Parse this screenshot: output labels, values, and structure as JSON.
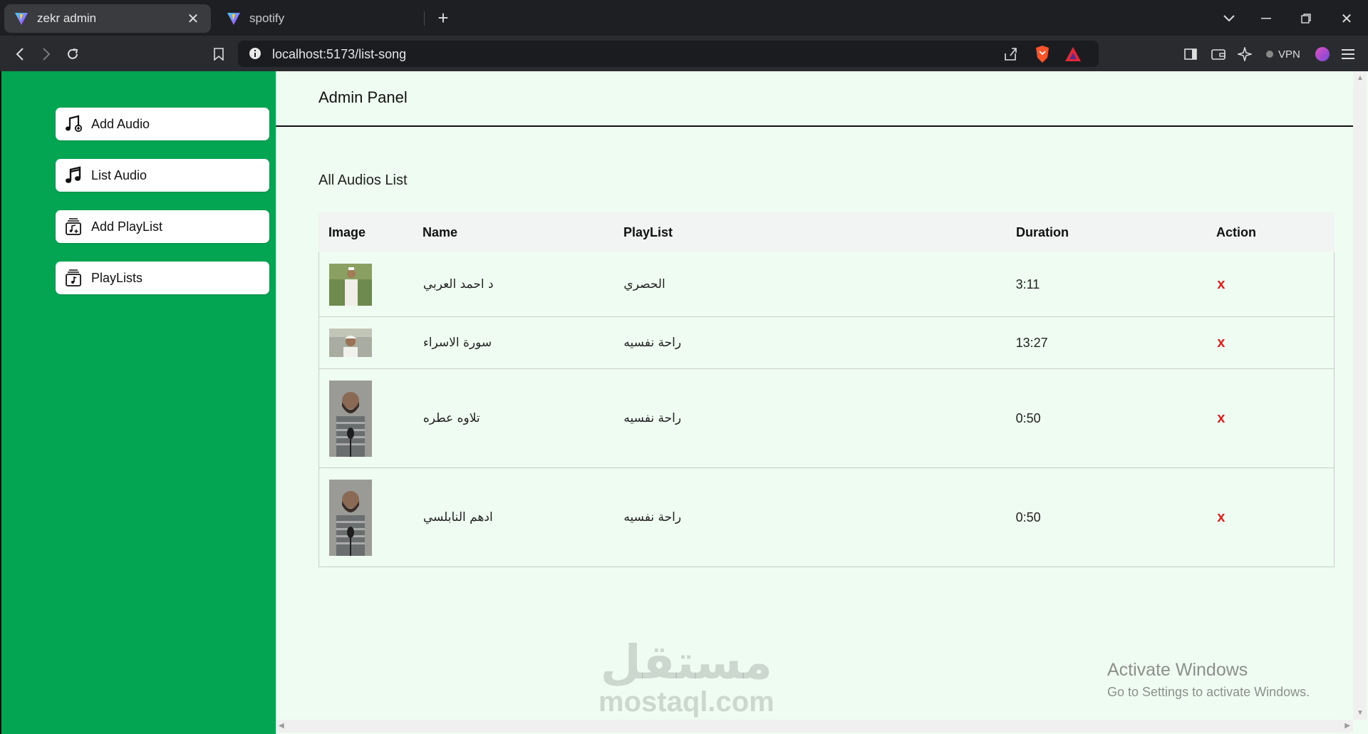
{
  "browser": {
    "tabs": [
      {
        "title": "zekr admin",
        "active": true
      },
      {
        "title": "spotify",
        "active": false
      }
    ],
    "url": "localhost:5173/list-song",
    "vpn_label": "VPN"
  },
  "sidebar": {
    "items": [
      {
        "label": "Add Audio",
        "icon": "music-add-icon"
      },
      {
        "label": "List Audio",
        "icon": "music-note-icon"
      },
      {
        "label": "Add PlayList",
        "icon": "playlist-add-icon"
      },
      {
        "label": "PlayLists",
        "icon": "playlist-icon"
      }
    ]
  },
  "header": {
    "title": "Admin Panel"
  },
  "main": {
    "section_title": "All Audios List",
    "columns": [
      "Image",
      "Name",
      "PlayList",
      "Duration",
      "Action"
    ],
    "rows": [
      {
        "name": "د احمد العربي",
        "playlist": "الحصري",
        "duration": "3:11",
        "action": "x"
      },
      {
        "name": "سورة الاسراء",
        "playlist": "راحة نفسيه",
        "duration": "13:27",
        "action": "x"
      },
      {
        "name": "تلاوه عطره",
        "playlist": "راحة نفسيه",
        "duration": "0:50",
        "action": "x"
      },
      {
        "name": "ادهم النابلسي",
        "playlist": "راحة نفسيه",
        "duration": "0:50",
        "action": "x"
      }
    ]
  },
  "overlay": {
    "watermark_ar": "مستقل",
    "watermark_en": "mostaql.com",
    "activate_title": "Activate Windows",
    "activate_sub": "Go to Settings to activate Windows."
  },
  "colors": {
    "sidebar_bg": "#03a553",
    "page_bg": "#eefcf1",
    "delete": "#e0201f"
  }
}
